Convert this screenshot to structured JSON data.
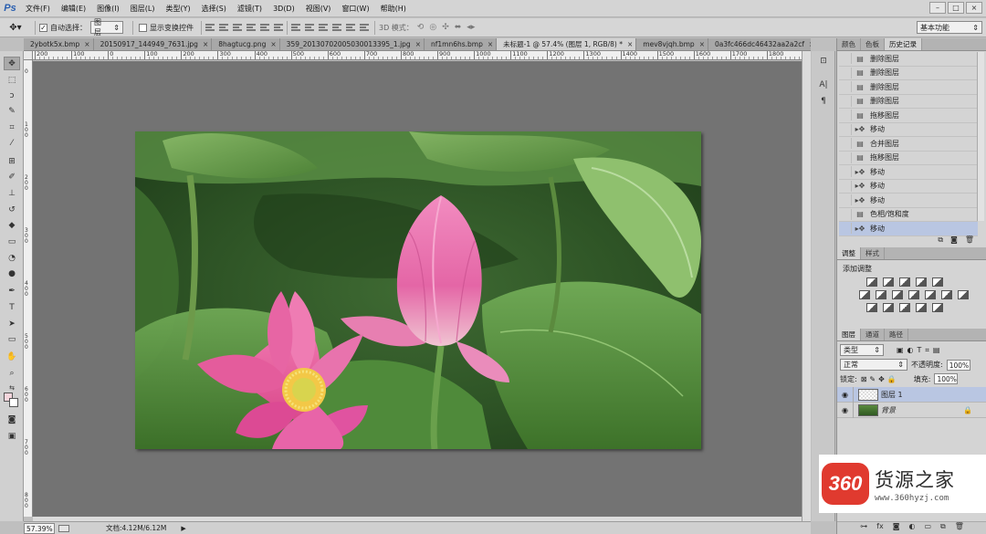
{
  "app": {
    "logo": "Ps"
  },
  "menu": [
    "文件(F)",
    "编辑(E)",
    "图像(I)",
    "图层(L)",
    "类型(Y)",
    "选择(S)",
    "滤镜(T)",
    "3D(D)",
    "视图(V)",
    "窗口(W)",
    "帮助(H)"
  ],
  "window_controls": [
    "–",
    "□",
    "×"
  ],
  "options": {
    "auto_select_label": "自动选择：",
    "auto_select_checked": true,
    "auto_select_value": "图层",
    "show_transform_label": "显示变换控件",
    "mode_3d_label": "3D 模式：",
    "workspace": "基本功能"
  },
  "tabs": [
    {
      "label": "2ybotk5x.bmp",
      "active": false
    },
    {
      "label": "20150917_144949_7631.jpg",
      "active": false
    },
    {
      "label": "8hagtucg.png",
      "active": false
    },
    {
      "label": "359_20130702005030013395_1.jpg",
      "active": false
    },
    {
      "label": "nf1mn6hs.bmp",
      "active": false
    },
    {
      "label": "未标题-1 @ 57.4% (图层 1, RGB/8) *",
      "active": true
    },
    {
      "label": "mev8vjqh.bmp",
      "active": false
    },
    {
      "label": "0a3fc466dc46432aa2a2cf",
      "active": false
    }
  ],
  "ruler_h": [
    "200",
    "100",
    "0",
    "100",
    "200",
    "300",
    "400",
    "500",
    "600",
    "700",
    "800",
    "900",
    "1000",
    "1100",
    "1200",
    "1300",
    "1400",
    "1500",
    "1600",
    "1700",
    "1800"
  ],
  "ruler_v": [
    "0",
    "100",
    "200",
    "300",
    "400",
    "500",
    "600",
    "700",
    "800"
  ],
  "status": {
    "zoom": "57.39%",
    "doc": "文档:4.12M/6.12M",
    "arrow": "▶"
  },
  "panel_tabs_top": [
    "颜色",
    "色板",
    "历史记录"
  ],
  "history": [
    {
      "label": "删除图层",
      "icon": "doc"
    },
    {
      "label": "删除图层",
      "icon": "doc"
    },
    {
      "label": "删除图层",
      "icon": "doc"
    },
    {
      "label": "删除图层",
      "icon": "doc"
    },
    {
      "label": "拖移图层",
      "icon": "doc"
    },
    {
      "label": "移动",
      "icon": "move"
    },
    {
      "label": "合并图层",
      "icon": "doc"
    },
    {
      "label": "拖移图层",
      "icon": "doc"
    },
    {
      "label": "移动",
      "icon": "move"
    },
    {
      "label": "移动",
      "icon": "move"
    },
    {
      "label": "移动",
      "icon": "move"
    },
    {
      "label": "色相/饱和度",
      "icon": "doc"
    },
    {
      "label": "移动",
      "icon": "move",
      "current": true
    }
  ],
  "panel_tabs_adj": [
    "调整",
    "样式"
  ],
  "adjustments_title": "添加调整",
  "panel_tabs_layers": [
    "图层",
    "通道",
    "路径"
  ],
  "layers_panel": {
    "filter_kind": "类型",
    "blend_mode": "正常",
    "opacity_label": "不透明度:",
    "opacity_value": "100%",
    "lock_label": "锁定:",
    "fill_label": "填充:",
    "fill_value": "100%"
  },
  "layers": [
    {
      "name": "图层 1",
      "thumb": "checker",
      "selected": true,
      "locked": false
    },
    {
      "name": "背景",
      "thumb": "photo",
      "selected": false,
      "locked": true
    }
  ],
  "watermark": {
    "badge": "360",
    "name": "货源之家",
    "url": "www.360hyzj.com"
  },
  "colors": {
    "foreground": "#f5d5dc",
    "background": "#ffffff",
    "selection": "#b9c6e2",
    "canvas_bg": "#737373"
  }
}
